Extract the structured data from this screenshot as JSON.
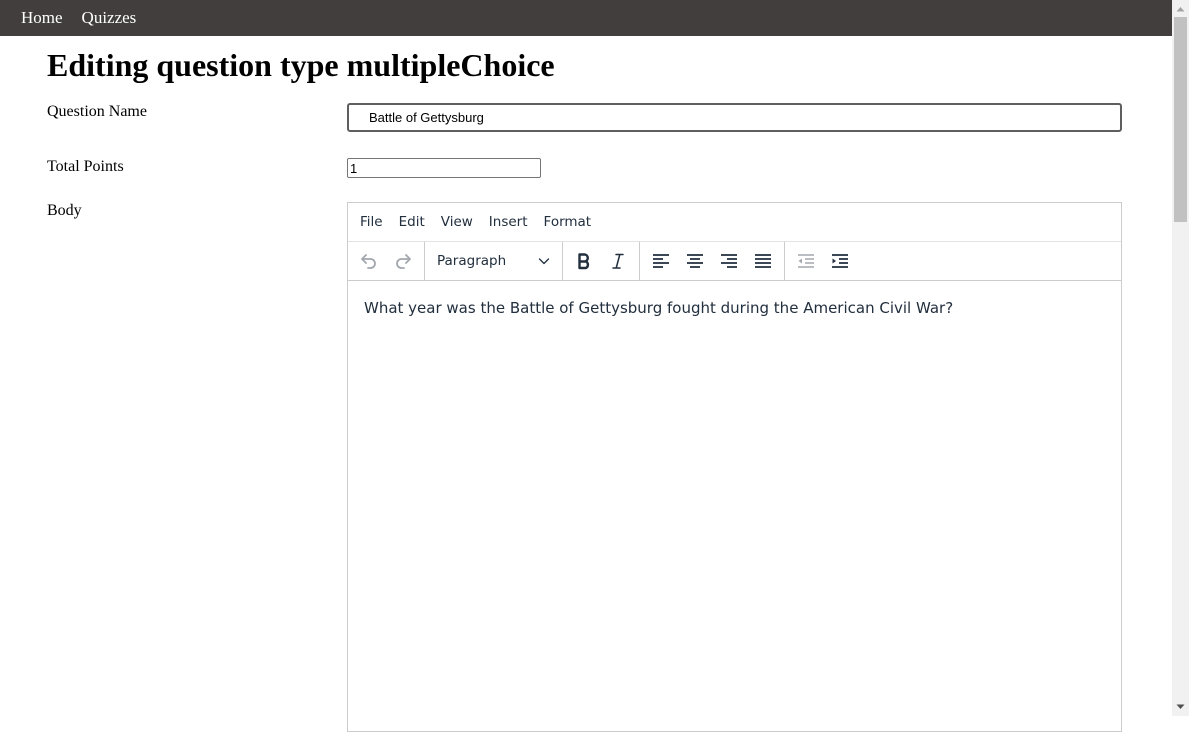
{
  "nav": {
    "links": [
      {
        "label": "Home"
      },
      {
        "label": "Quizzes"
      }
    ]
  },
  "page": {
    "title": "Editing question type multipleChoice"
  },
  "form": {
    "question_name": {
      "label": "Question Name",
      "value": "Battle of Gettysburg"
    },
    "total_points": {
      "label": "Total Points",
      "value": "1"
    },
    "body": {
      "label": "Body"
    }
  },
  "editor": {
    "menu": [
      {
        "label": "File"
      },
      {
        "label": "Edit"
      },
      {
        "label": "View"
      },
      {
        "label": "Insert"
      },
      {
        "label": "Format"
      }
    ],
    "block_format": "Paragraph",
    "toolbar_icons": [
      "undo-icon",
      "redo-icon",
      "bold-icon",
      "italic-icon",
      "align-left-icon",
      "align-center-icon",
      "align-right-icon",
      "align-justify-icon",
      "outdent-icon",
      "indent-icon"
    ],
    "content": "What year was the Battle of Gettysburg fought during the American Civil War?"
  },
  "colors": {
    "navbar_bg": "#423e3d",
    "editor_text": "#222f3e",
    "disabled_icon": "#a3a8ae"
  }
}
